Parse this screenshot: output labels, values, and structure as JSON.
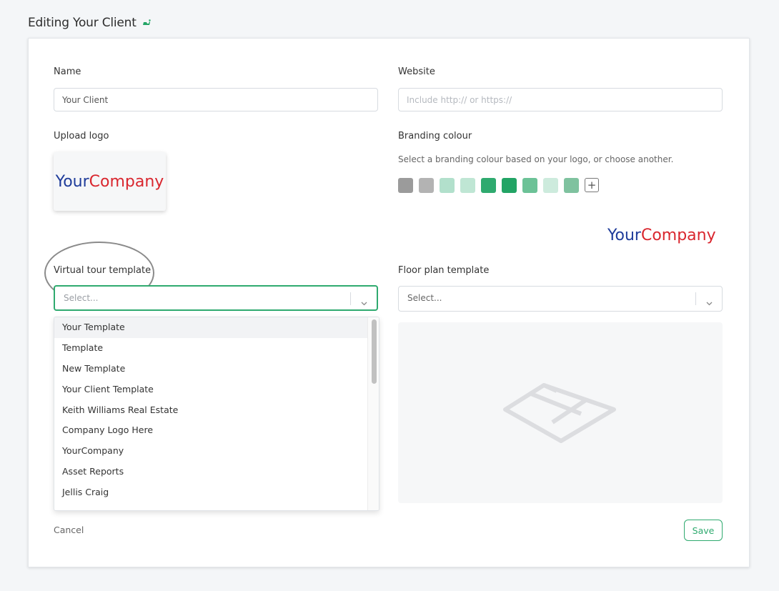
{
  "page": {
    "title": "Editing Your Client"
  },
  "form": {
    "name_label": "Name",
    "name_value": "Your Client",
    "website_label": "Website",
    "website_placeholder": "Include http:// or https://",
    "logo_label": "Upload logo",
    "logo_text_part1": "Your",
    "logo_text_part2": "Company",
    "branding_label": "Branding colour",
    "branding_help": "Select a branding colour based on your logo, or choose another.",
    "swatches": [
      "#9b9b9b",
      "#b3b3b3",
      "#b2e0cc",
      "#bfe6d4",
      "#2faa6f",
      "#22a465",
      "#6cc297",
      "#cdebdd",
      "#7fc29f"
    ],
    "add_swatch_symbol": "+",
    "virtual_tour_label": "Virtual tour template",
    "virtual_tour_placeholder": "Select...",
    "floor_plan_label": "Floor plan template",
    "floor_plan_placeholder": "Select...",
    "dropdown_options": [
      "Your Template",
      "Template",
      "New Template",
      "Your Client Template",
      "Keith Williams Real Estate",
      "Company Logo Here",
      "YourCompany",
      "Asset Reports",
      "Jellis Craig"
    ],
    "cancel_label": "Cancel",
    "save_label": "Save"
  },
  "colors": {
    "accent": "#2faa6f",
    "logo_blue": "#1f3c9a",
    "logo_red": "#d9262e"
  },
  "icons": [
    "edit-icon",
    "chevron-down-icon",
    "floor-plan-icon"
  ]
}
